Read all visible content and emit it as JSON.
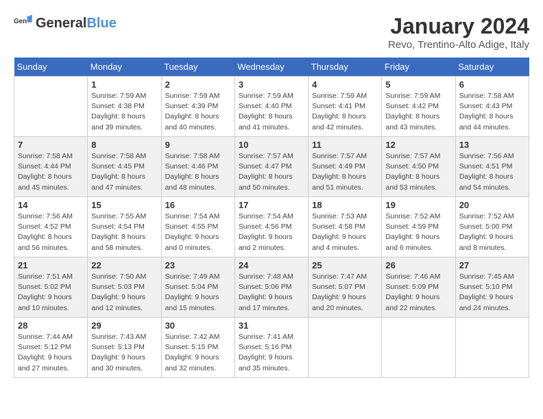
{
  "logo": {
    "general": "General",
    "blue": "Blue"
  },
  "title": "January 2024",
  "subtitle": "Revo, Trentino-Alto Adige, Italy",
  "days_of_week": [
    "Sunday",
    "Monday",
    "Tuesday",
    "Wednesday",
    "Thursday",
    "Friday",
    "Saturday"
  ],
  "weeks": [
    [
      {
        "day": "",
        "sunrise": "",
        "sunset": "",
        "daylight": ""
      },
      {
        "day": "1",
        "sunrise": "Sunrise: 7:59 AM",
        "sunset": "Sunset: 4:38 PM",
        "daylight": "Daylight: 8 hours and 39 minutes."
      },
      {
        "day": "2",
        "sunrise": "Sunrise: 7:59 AM",
        "sunset": "Sunset: 4:39 PM",
        "daylight": "Daylight: 8 hours and 40 minutes."
      },
      {
        "day": "3",
        "sunrise": "Sunrise: 7:59 AM",
        "sunset": "Sunset: 4:40 PM",
        "daylight": "Daylight: 8 hours and 41 minutes."
      },
      {
        "day": "4",
        "sunrise": "Sunrise: 7:59 AM",
        "sunset": "Sunset: 4:41 PM",
        "daylight": "Daylight: 8 hours and 42 minutes."
      },
      {
        "day": "5",
        "sunrise": "Sunrise: 7:59 AM",
        "sunset": "Sunset: 4:42 PM",
        "daylight": "Daylight: 8 hours and 43 minutes."
      },
      {
        "day": "6",
        "sunrise": "Sunrise: 7:58 AM",
        "sunset": "Sunset: 4:43 PM",
        "daylight": "Daylight: 8 hours and 44 minutes."
      }
    ],
    [
      {
        "day": "7",
        "sunrise": "Sunrise: 7:58 AM",
        "sunset": "Sunset: 4:44 PM",
        "daylight": "Daylight: 8 hours and 45 minutes."
      },
      {
        "day": "8",
        "sunrise": "Sunrise: 7:58 AM",
        "sunset": "Sunset: 4:45 PM",
        "daylight": "Daylight: 8 hours and 47 minutes."
      },
      {
        "day": "9",
        "sunrise": "Sunrise: 7:58 AM",
        "sunset": "Sunset: 4:46 PM",
        "daylight": "Daylight: 8 hours and 48 minutes."
      },
      {
        "day": "10",
        "sunrise": "Sunrise: 7:57 AM",
        "sunset": "Sunset: 4:47 PM",
        "daylight": "Daylight: 8 hours and 50 minutes."
      },
      {
        "day": "11",
        "sunrise": "Sunrise: 7:57 AM",
        "sunset": "Sunset: 4:49 PM",
        "daylight": "Daylight: 8 hours and 51 minutes."
      },
      {
        "day": "12",
        "sunrise": "Sunrise: 7:57 AM",
        "sunset": "Sunset: 4:50 PM",
        "daylight": "Daylight: 8 hours and 53 minutes."
      },
      {
        "day": "13",
        "sunrise": "Sunrise: 7:56 AM",
        "sunset": "Sunset: 4:51 PM",
        "daylight": "Daylight: 8 hours and 54 minutes."
      }
    ],
    [
      {
        "day": "14",
        "sunrise": "Sunrise: 7:56 AM",
        "sunset": "Sunset: 4:52 PM",
        "daylight": "Daylight: 8 hours and 56 minutes."
      },
      {
        "day": "15",
        "sunrise": "Sunrise: 7:55 AM",
        "sunset": "Sunset: 4:54 PM",
        "daylight": "Daylight: 8 hours and 58 minutes."
      },
      {
        "day": "16",
        "sunrise": "Sunrise: 7:54 AM",
        "sunset": "Sunset: 4:55 PM",
        "daylight": "Daylight: 9 hours and 0 minutes."
      },
      {
        "day": "17",
        "sunrise": "Sunrise: 7:54 AM",
        "sunset": "Sunset: 4:56 PM",
        "daylight": "Daylight: 9 hours and 2 minutes."
      },
      {
        "day": "18",
        "sunrise": "Sunrise: 7:53 AM",
        "sunset": "Sunset: 4:58 PM",
        "daylight": "Daylight: 9 hours and 4 minutes."
      },
      {
        "day": "19",
        "sunrise": "Sunrise: 7:52 AM",
        "sunset": "Sunset: 4:59 PM",
        "daylight": "Daylight: 9 hours and 6 minutes."
      },
      {
        "day": "20",
        "sunrise": "Sunrise: 7:52 AM",
        "sunset": "Sunset: 5:00 PM",
        "daylight": "Daylight: 9 hours and 8 minutes."
      }
    ],
    [
      {
        "day": "21",
        "sunrise": "Sunrise: 7:51 AM",
        "sunset": "Sunset: 5:02 PM",
        "daylight": "Daylight: 9 hours and 10 minutes."
      },
      {
        "day": "22",
        "sunrise": "Sunrise: 7:50 AM",
        "sunset": "Sunset: 5:03 PM",
        "daylight": "Daylight: 9 hours and 12 minutes."
      },
      {
        "day": "23",
        "sunrise": "Sunrise: 7:49 AM",
        "sunset": "Sunset: 5:04 PM",
        "daylight": "Daylight: 9 hours and 15 minutes."
      },
      {
        "day": "24",
        "sunrise": "Sunrise: 7:48 AM",
        "sunset": "Sunset: 5:06 PM",
        "daylight": "Daylight: 9 hours and 17 minutes."
      },
      {
        "day": "25",
        "sunrise": "Sunrise: 7:47 AM",
        "sunset": "Sunset: 5:07 PM",
        "daylight": "Daylight: 9 hours and 20 minutes."
      },
      {
        "day": "26",
        "sunrise": "Sunrise: 7:46 AM",
        "sunset": "Sunset: 5:09 PM",
        "daylight": "Daylight: 9 hours and 22 minutes."
      },
      {
        "day": "27",
        "sunrise": "Sunrise: 7:45 AM",
        "sunset": "Sunset: 5:10 PM",
        "daylight": "Daylight: 9 hours and 24 minutes."
      }
    ],
    [
      {
        "day": "28",
        "sunrise": "Sunrise: 7:44 AM",
        "sunset": "Sunset: 5:12 PM",
        "daylight": "Daylight: 9 hours and 27 minutes."
      },
      {
        "day": "29",
        "sunrise": "Sunrise: 7:43 AM",
        "sunset": "Sunset: 5:13 PM",
        "daylight": "Daylight: 9 hours and 30 minutes."
      },
      {
        "day": "30",
        "sunrise": "Sunrise: 7:42 AM",
        "sunset": "Sunset: 5:15 PM",
        "daylight": "Daylight: 9 hours and 32 minutes."
      },
      {
        "day": "31",
        "sunrise": "Sunrise: 7:41 AM",
        "sunset": "Sunset: 5:16 PM",
        "daylight": "Daylight: 9 hours and 35 minutes."
      },
      {
        "day": "",
        "sunrise": "",
        "sunset": "",
        "daylight": ""
      },
      {
        "day": "",
        "sunrise": "",
        "sunset": "",
        "daylight": ""
      },
      {
        "day": "",
        "sunrise": "",
        "sunset": "",
        "daylight": ""
      }
    ]
  ]
}
